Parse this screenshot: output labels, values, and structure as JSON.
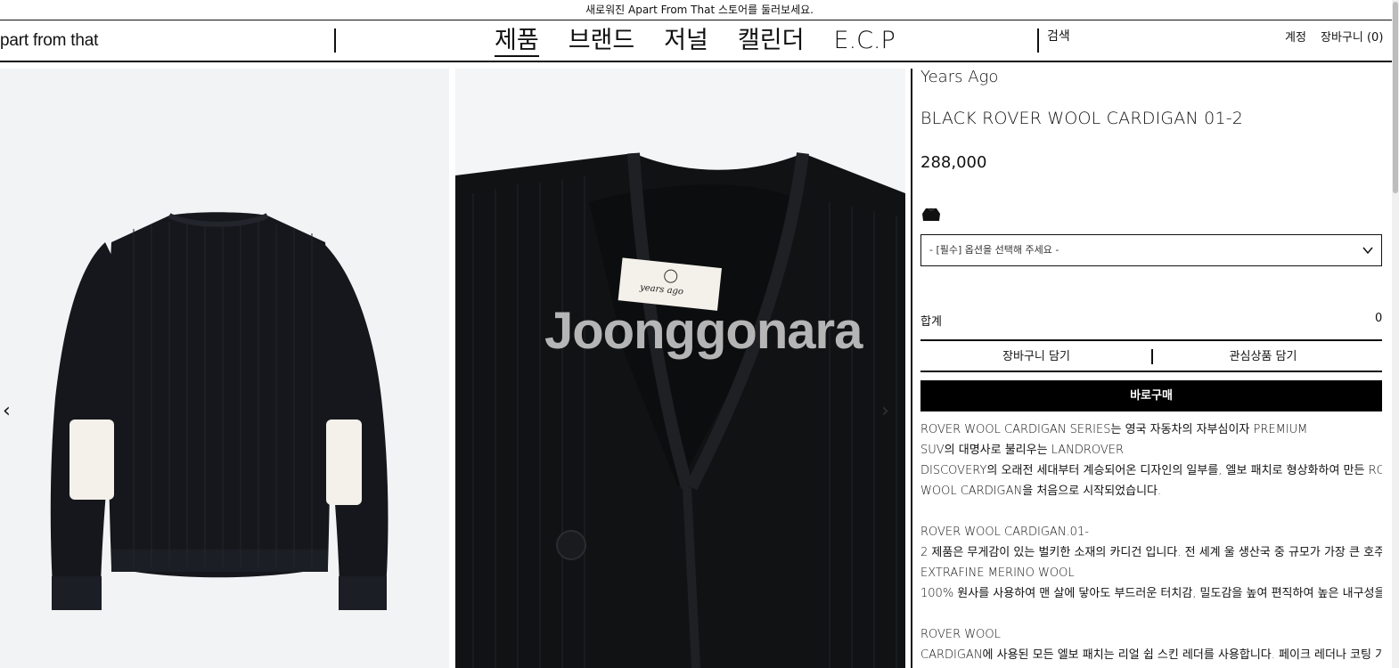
{
  "announcement": "새로워진 Apart From That 스토어를 둘러보세요.",
  "header": {
    "logo": "part from that",
    "nav": [
      "제품",
      "브랜드",
      "저널",
      "캘린더",
      "E.C.P"
    ],
    "search_label": "검색",
    "account_label": "계정",
    "cart_label": "장바구니 (0)"
  },
  "gallery": {
    "watermark": "Joonggonara",
    "label_text": "years ago",
    "prev_glyph": "‹",
    "next_glyph": "›"
  },
  "product": {
    "brand": "Years Ago",
    "name": "BLACK ROVER WOOL CARDIGAN 01-2",
    "price": "288,000",
    "option_placeholder": "- [필수] 옵션을 선택해 주세요 -",
    "total_label": "합계",
    "total_value": "0",
    "add_to_cart": "장바구니 담기",
    "add_to_wishlist": "관심상품 담기",
    "buy_now": "바로구매"
  },
  "description": {
    "lines": [
      "ROVER WOOL CARDIGAN SERIES는 영국 자동차의 자부심이자 PREMIUM",
      "SUV의 대명사로 불리우는 LANDROVER",
      "DISCOVERY의 오래전 세대부터 계승되어온 디자인의 일부를, 엘보 패치로 형상화하여 만든 ROVER",
      "WOOL CARDIGAN을 처음으로 시작되었습니다.",
      "",
      "ROVER WOOL CARDIGAN.01-",
      "2 제품은 무게감이 있는 벌키한 소재의 카디건 입니다. 전 세계 울 생산국 중 규모가 가장 큰 호주산 S",
      "EXTRAFINE MERINO WOOL",
      "100% 원사를 사용하여 맨 살에 닿아도 부드러운 터치감, 밀도감을 높여 편직하여 높은 내구성을 뽐내",
      "",
      "ROVER WOOL",
      "CARDIGAN에 사용된 모든 엘보 패치는 리얼 쉽 스킨 레더를 사용합니다. 페이크 레더나 코팅 가공"
    ]
  },
  "colors": {
    "text": "#111111",
    "buy_button_bg": "#000000",
    "sweater": "#15171c",
    "patch": "#f3f1ea"
  }
}
